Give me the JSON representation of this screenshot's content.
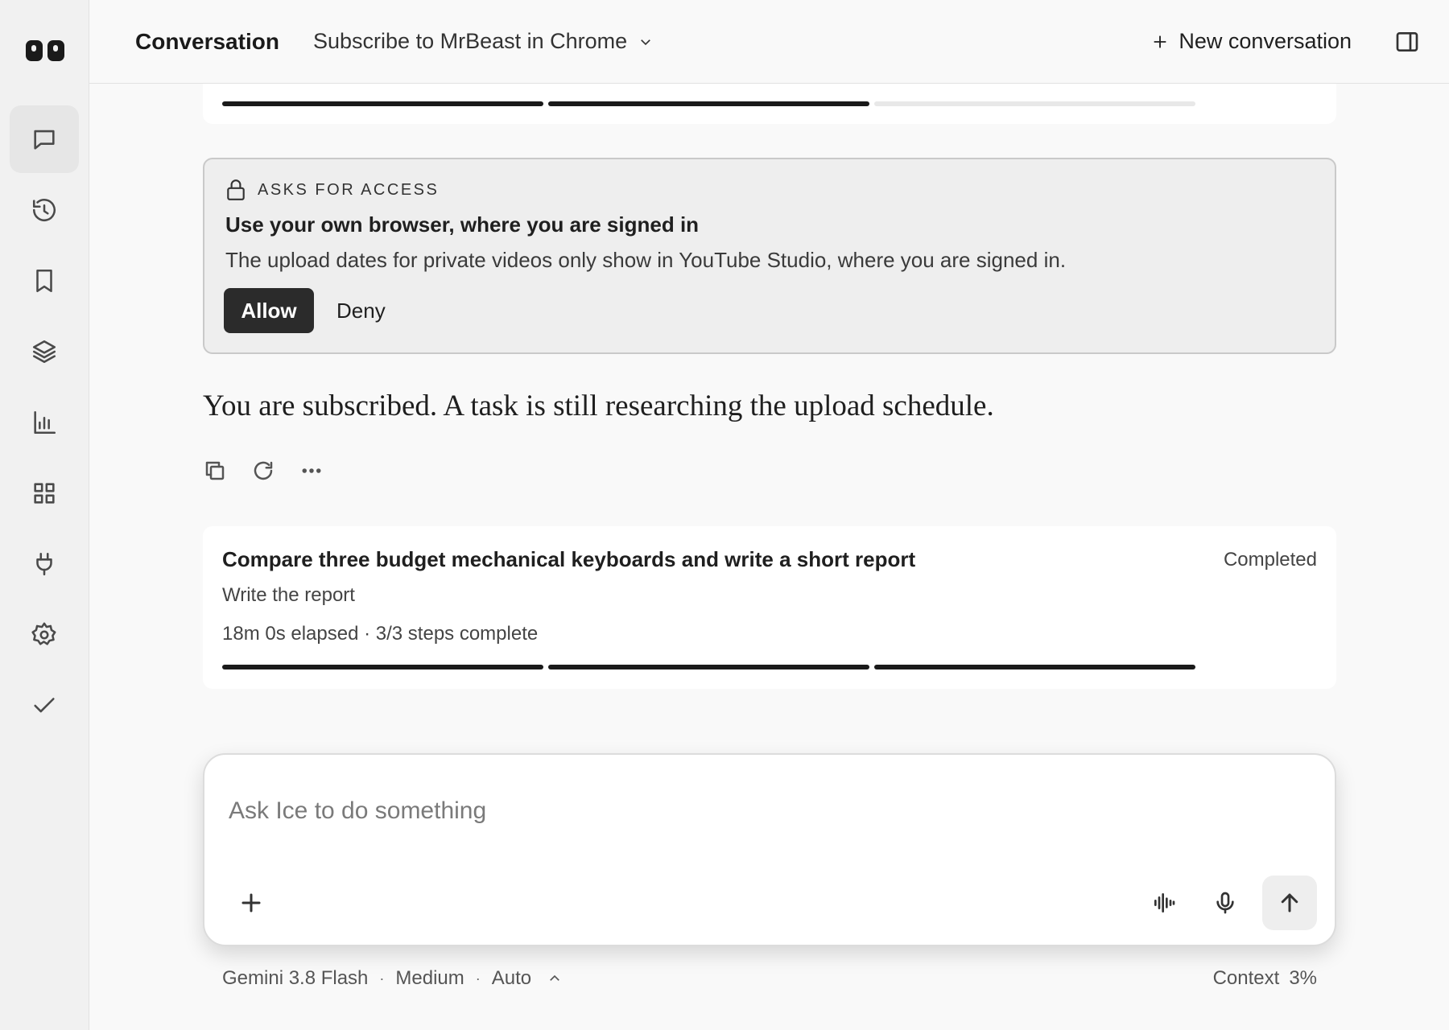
{
  "header": {
    "title": "Conversation",
    "conversation_name": "Subscribe to MrBeast in Chrome",
    "new_conversation_label": "New conversation"
  },
  "sidebar": {
    "items": [
      {
        "icon": "chat-icon",
        "active": true
      },
      {
        "icon": "history-icon",
        "active": false
      },
      {
        "icon": "bookmark-icon",
        "active": false
      },
      {
        "icon": "layers-icon",
        "active": false
      },
      {
        "icon": "chart-icon",
        "active": false
      },
      {
        "icon": "grid-icon",
        "active": false
      },
      {
        "icon": "plug-icon",
        "active": false
      },
      {
        "icon": "gear-icon",
        "active": false
      },
      {
        "icon": "check-icon",
        "active": false
      }
    ]
  },
  "top_task_progress": {
    "completed_steps": 2,
    "total_steps": 3
  },
  "access_request": {
    "label": "ASKS FOR ACCESS",
    "heading": "Use your own browser, where you are signed in",
    "description": "The upload dates for private videos only show in YouTube Studio, where you are signed in.",
    "allow_label": "Allow",
    "deny_label": "Deny"
  },
  "reply": {
    "text": "You are subscribed. A task is still researching the upload schedule."
  },
  "task": {
    "title": "Compare three budget mechanical keyboards and write a short report",
    "status": "Completed",
    "current_step": "Write the report",
    "meta": "18m 0s elapsed · 3/3 steps complete",
    "completed_steps": 3,
    "total_steps": 3
  },
  "composer": {
    "placeholder": "Ask Ice to do something",
    "value": ""
  },
  "footer": {
    "model": "Gemini 3.8 Flash",
    "effort": "Medium",
    "mode": "Auto",
    "separator": "·",
    "context_label": "Context",
    "context_value": "3%"
  },
  "colors": {
    "accent": "#2b2b2b",
    "progress_fill": "#1a1a1a",
    "progress_empty": "#e8e8e8"
  }
}
